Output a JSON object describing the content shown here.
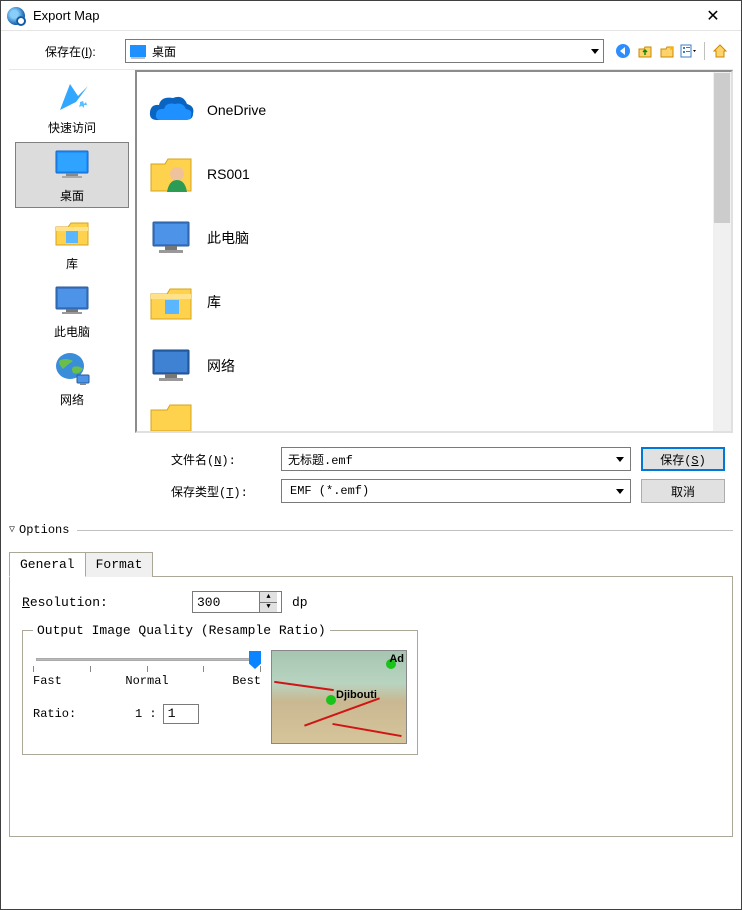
{
  "window": {
    "title": "Export Map",
    "close_symbol": "✕"
  },
  "lookin": {
    "label_pre": "保存在(",
    "label_key": "I",
    "label_post": "):",
    "value": "桌面"
  },
  "toolbar_icons": {
    "back": "back-icon",
    "up": "up-one-level-icon",
    "new_folder": "new-folder-icon",
    "views": "views-icon",
    "home": "home-icon"
  },
  "places": [
    {
      "id": "quick-access",
      "label": "快速访问",
      "icon": "star"
    },
    {
      "id": "desktop",
      "label": "桌面",
      "icon": "monitor",
      "selected": true
    },
    {
      "id": "libraries",
      "label": "库",
      "icon": "folder"
    },
    {
      "id": "this-pc",
      "label": "此电脑",
      "icon": "monitor"
    },
    {
      "id": "network",
      "label": "网络",
      "icon": "globe"
    }
  ],
  "file_items": [
    {
      "label": "OneDrive",
      "icon": "onedrive"
    },
    {
      "label": "RS001",
      "icon": "folder-user"
    },
    {
      "label": "此电脑",
      "icon": "monitor"
    },
    {
      "label": "库",
      "icon": "folder"
    },
    {
      "label": "网络",
      "icon": "monitor"
    }
  ],
  "fields": {
    "filename_label_pre": "文件名(",
    "filename_label_key": "N",
    "filename_label_post": "):",
    "filename_value": "无标题.emf",
    "savetype_label_pre": "保存类型(",
    "savetype_label_key": "T",
    "savetype_label_post": "):",
    "savetype_value": "EMF (*.emf)"
  },
  "buttons": {
    "save_pre": "保存(",
    "save_key": "S",
    "save_post": ")",
    "cancel": "取消"
  },
  "options": {
    "header": "Options",
    "tabs": {
      "general": "General",
      "format": "Format"
    },
    "resolution_label_key": "R",
    "resolution_label_rest": "esolution:",
    "resolution_value": "300",
    "resolution_unit": "dp",
    "oiq_legend": "Output Image Quality (Resample Ratio)",
    "slider_labels": {
      "fast": "Fast",
      "normal": "Normal",
      "best": "Best"
    },
    "ratio_label": "Ratio:",
    "ratio_prefix": "1 :",
    "ratio_value": "1",
    "preview_labels": {
      "city1": "Djibouti",
      "city2": "Ad"
    }
  },
  "watermark": ""
}
